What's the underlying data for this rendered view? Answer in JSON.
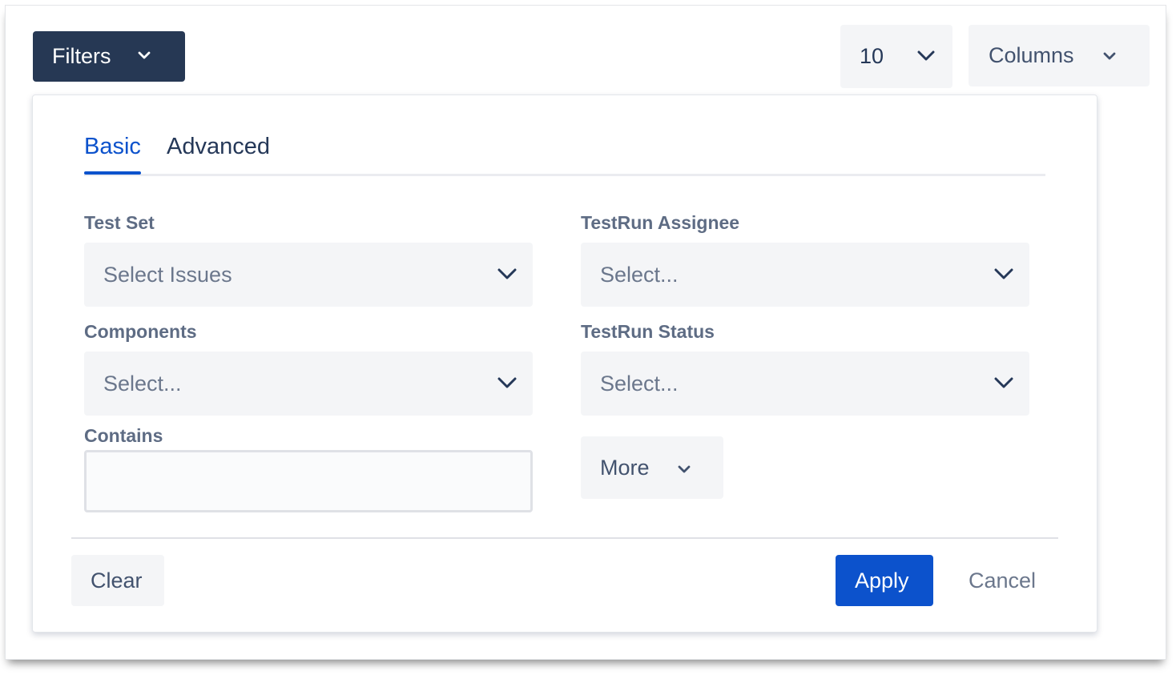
{
  "toolbar": {
    "filters_label": "Filters",
    "page_size_value": "10",
    "columns_label": "Columns"
  },
  "filter_panel": {
    "tabs": [
      {
        "label": "Basic",
        "active": true
      },
      {
        "label": "Advanced",
        "active": false
      }
    ],
    "fields": {
      "test_set": {
        "label": "Test Set",
        "placeholder": "Select Issues"
      },
      "testrun_assignee": {
        "label": "TestRun Assignee",
        "placeholder": "Select..."
      },
      "components": {
        "label": "Components",
        "placeholder": "Select..."
      },
      "testrun_status": {
        "label": "TestRun Status",
        "placeholder": "Select..."
      },
      "contains": {
        "label": "Contains",
        "value": ""
      }
    },
    "more_label": "More",
    "clear_label": "Clear",
    "apply_label": "Apply",
    "cancel_label": "Cancel"
  },
  "icons": {
    "dropdown": "chevron-down-icon"
  },
  "colors": {
    "filters_button_bg": "#263854",
    "accent_blue": "#0c52cc",
    "field_bg": "#f4f5f7",
    "label_text": "#5e6c84"
  }
}
